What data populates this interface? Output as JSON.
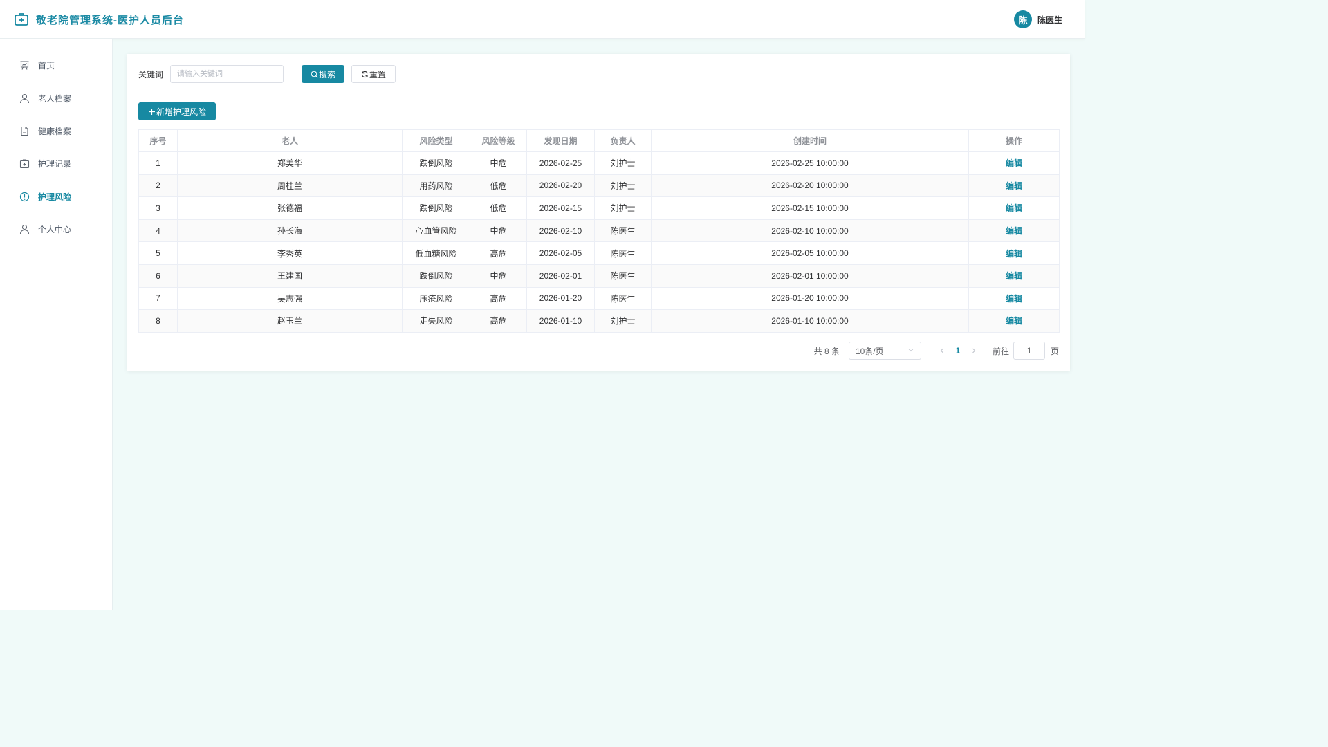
{
  "header": {
    "title": "敬老院管理系统-医护人员后台",
    "avatar_text": "陈",
    "user_name": "陈医生",
    "accent_color": "#1789a2"
  },
  "sidebar": {
    "items": [
      {
        "label": "首页",
        "icon": "presentation-icon",
        "active": false
      },
      {
        "label": "老人档案",
        "icon": "user-icon",
        "active": false
      },
      {
        "label": "健康档案",
        "icon": "document-icon",
        "active": false
      },
      {
        "label": "护理记录",
        "icon": "medical-kit-icon",
        "active": false
      },
      {
        "label": "护理风险",
        "icon": "warning-circle-icon",
        "active": true
      },
      {
        "label": "个人中心",
        "icon": "user-icon",
        "active": false
      }
    ]
  },
  "search": {
    "label": "关键词",
    "placeholder": "请输入关键词",
    "value": "",
    "search_button": "搜索",
    "reset_button": "重置"
  },
  "toolbar": {
    "add_button": "新增护理风险"
  },
  "table": {
    "columns": [
      "序号",
      "老人",
      "风险类型",
      "风险等级",
      "发现日期",
      "负责人",
      "创建时间",
      "操作"
    ],
    "rows": [
      {
        "no": "1",
        "elder": "郑美华",
        "type": "跌倒风险",
        "level": "中危",
        "date": "2026-02-25",
        "owner": "刘护士",
        "created": "2026-02-25 10:00:00",
        "action": "编辑"
      },
      {
        "no": "2",
        "elder": "周桂兰",
        "type": "用药风险",
        "level": "低危",
        "date": "2026-02-20",
        "owner": "刘护士",
        "created": "2026-02-20 10:00:00",
        "action": "编辑"
      },
      {
        "no": "3",
        "elder": "张德福",
        "type": "跌倒风险",
        "level": "低危",
        "date": "2026-02-15",
        "owner": "刘护士",
        "created": "2026-02-15 10:00:00",
        "action": "编辑"
      },
      {
        "no": "4",
        "elder": "孙长海",
        "type": "心血管风险",
        "level": "中危",
        "date": "2026-02-10",
        "owner": "陈医生",
        "created": "2026-02-10 10:00:00",
        "action": "编辑"
      },
      {
        "no": "5",
        "elder": "李秀英",
        "type": "低血糖风险",
        "level": "高危",
        "date": "2026-02-05",
        "owner": "陈医生",
        "created": "2026-02-05 10:00:00",
        "action": "编辑"
      },
      {
        "no": "6",
        "elder": "王建国",
        "type": "跌倒风险",
        "level": "中危",
        "date": "2026-02-01",
        "owner": "陈医生",
        "created": "2026-02-01 10:00:00",
        "action": "编辑"
      },
      {
        "no": "7",
        "elder": "吴志强",
        "type": "压疮风险",
        "level": "高危",
        "date": "2026-01-20",
        "owner": "陈医生",
        "created": "2026-01-20 10:00:00",
        "action": "编辑"
      },
      {
        "no": "8",
        "elder": "赵玉兰",
        "type": "走失风险",
        "level": "高危",
        "date": "2026-01-10",
        "owner": "刘护士",
        "created": "2026-01-10 10:00:00",
        "action": "编辑"
      }
    ]
  },
  "pagination": {
    "total": "共 8 条",
    "page_size": "10条/页",
    "current_page": "1",
    "goto_label": "前往",
    "goto_value": "1",
    "page_unit": "页"
  }
}
